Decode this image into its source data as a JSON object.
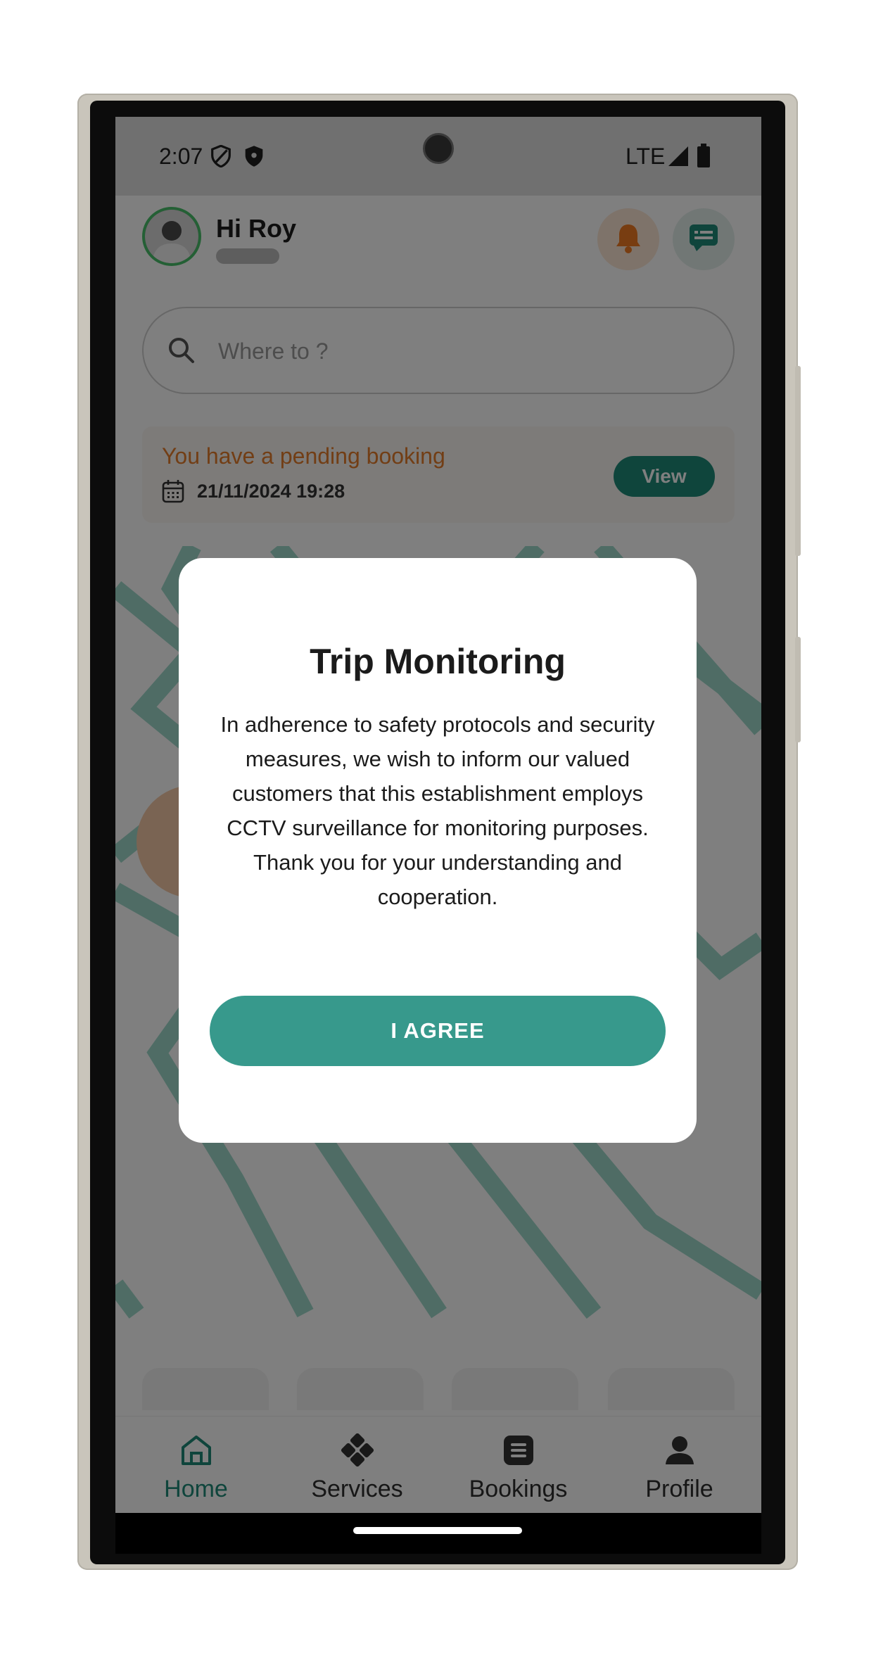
{
  "status_bar": {
    "time": "2:07",
    "network": "LTE"
  },
  "header": {
    "greeting": "Hi Roy"
  },
  "search": {
    "placeholder": "Where to ?"
  },
  "booking": {
    "title": "You have a pending booking",
    "datetime": "21/11/2024 19:28",
    "view_label": "View"
  },
  "nav": {
    "items": [
      {
        "label": "Home",
        "icon": "home-icon",
        "active": true
      },
      {
        "label": "Services",
        "icon": "services-icon",
        "active": false
      },
      {
        "label": "Bookings",
        "icon": "bookings-icon",
        "active": false
      },
      {
        "label": "Profile",
        "icon": "profile-icon",
        "active": false
      }
    ]
  },
  "modal": {
    "title": "Trip Monitoring",
    "body": "In adherence to safety protocols and security measures, we wish to inform our valued customers that this establishment employs CCTV surveillance for monitoring purposes. Thank you for your understanding and cooperation.",
    "agree_label": "I AGREE"
  },
  "colors": {
    "accent": "#37998c",
    "nav_active": "#1f8a79",
    "booking_title": "#e47c2b",
    "bell": "#f07b22"
  }
}
